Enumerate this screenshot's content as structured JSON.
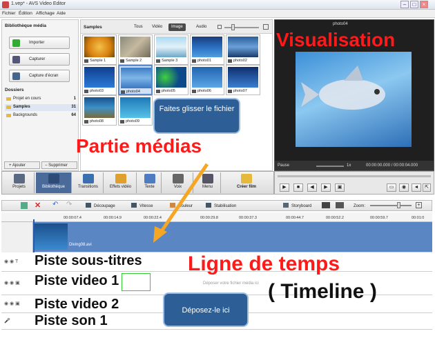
{
  "window": {
    "title": "1.vep* - AVS Video Editor"
  },
  "menu": [
    "Fichier",
    "Édition",
    "Affichage",
    "Aide"
  ],
  "library": {
    "title": "Bibliothèque média",
    "buttons": [
      "Importer",
      "Capturer",
      "Capture d'écran"
    ],
    "folders_title": "Dossiers",
    "folders": [
      {
        "name": "Projet en cours",
        "count": "1"
      },
      {
        "name": "Samples",
        "count": "31"
      },
      {
        "name": "Backgrounds",
        "count": "64"
      }
    ],
    "add": "Ajouter",
    "remove": "Supprimer"
  },
  "samples": {
    "title": "Samples",
    "tabs": [
      "Tous",
      "Vidéo",
      "Image",
      "Audio"
    ],
    "active_tab": "Image",
    "items": [
      "Sample 1",
      "Sample 2",
      "Sample 3",
      "photo01",
      "photo02",
      "photo03",
      "photo04",
      "photo05",
      "photo06",
      "photo07",
      "photo08",
      "photo09"
    ]
  },
  "preview": {
    "title": "photo04",
    "status": "Pause",
    "speed": "1x",
    "time": "00:00:00.000 / 00:00:04.000"
  },
  "toolbar": [
    "Projets",
    "Bibliothèque",
    "Transitions",
    "Effets vidéo",
    "Texte",
    "Voix",
    "Menu",
    "Créer film"
  ],
  "timeline_tools": [
    "Découpage",
    "Vitesse",
    "Couleur",
    "Stabilisation",
    "Storyboard",
    "Zoom:"
  ],
  "ruler": [
    "00:00:07.4",
    "00:00:14.9",
    "00:00:22.4",
    "00:00:29.8",
    "00:00:37.3",
    "00:00:44.7",
    "00:00:52.2",
    "00:00:59.7",
    "00:01:0"
  ],
  "clip": {
    "name": "Diving08.avi"
  },
  "drop_hint": "Déposer votre fichier média ici",
  "tracks": [
    "Piste sous-titres",
    "Piste video 1",
    "Piste video 2",
    "Piste son 1"
  ],
  "annotations": {
    "visualisation": "Visualisation",
    "partie_medias": "Partie médias",
    "ligne_de_temps": "Ligne de temps",
    "timeline": "( Timeline )",
    "tip_drag": "Faites glisser le fichier",
    "tip_drop": "Déposez-le ici"
  },
  "colors": {
    "annotation_red": "#ff1a1a",
    "tooltip_blue": "#2d5f96",
    "arrow_orange": "#f5a623",
    "clip_blue": "#5a86c4"
  }
}
